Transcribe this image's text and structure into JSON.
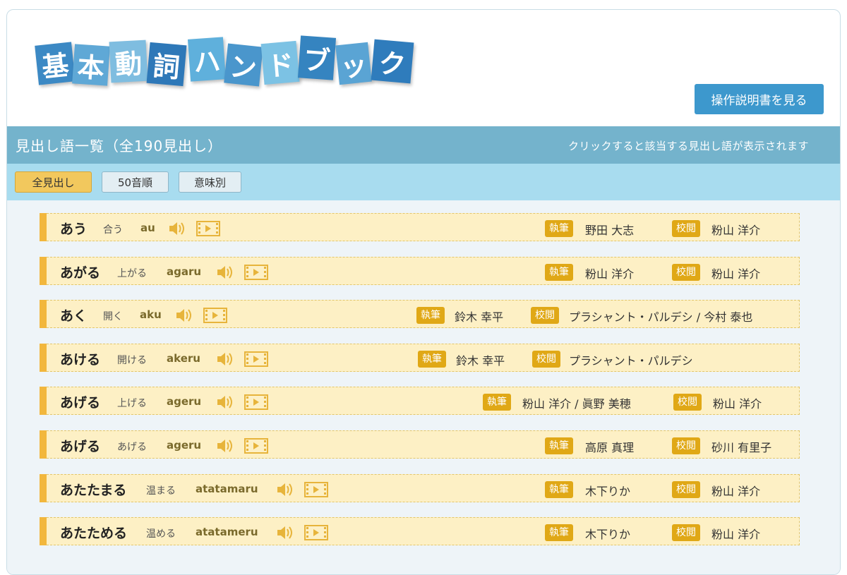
{
  "logo": {
    "chars": [
      "基",
      "本",
      "動",
      "詞",
      "ハ",
      "ン",
      "ド",
      "ブ",
      "ッ",
      "ク"
    ],
    "colors": [
      "#3c89c4",
      "#5fa8d6",
      "#7fbde0",
      "#2e78b8",
      "#5fb0dc",
      "#4a96cc",
      "#7cc2e4",
      "#3584c0",
      "#5aa4d4",
      "#2f7cbc"
    ]
  },
  "header": {
    "manual_button": "操作説明書を見る"
  },
  "titlebar": {
    "title": "見出し語一覧（全190見出し）",
    "hint": "クリックすると該当する見出し語が表示されます"
  },
  "tabs": [
    {
      "label": "全見出し",
      "active": true
    },
    {
      "label": "50音順",
      "active": false
    },
    {
      "label": "意味別",
      "active": false
    }
  ],
  "labels": {
    "writer": "執筆",
    "reviewer": "校閲"
  },
  "entries": [
    {
      "word": "あう",
      "kanji": "合う",
      "romaji": "au",
      "writer": "野田 大志",
      "reviewer": "粉山 洋介"
    },
    {
      "word": "あがる",
      "kanji": "上がる",
      "romaji": "agaru",
      "writer": "粉山 洋介",
      "reviewer": "粉山 洋介"
    },
    {
      "word": "あく",
      "kanji": "開く",
      "romaji": "aku",
      "writer": "鈴木 幸平",
      "reviewer": "プラシャント・パルデシ / 今村 泰也"
    },
    {
      "word": "あける",
      "kanji": "開ける",
      "romaji": "akeru",
      "writer": "鈴木 幸平",
      "reviewer": "プラシャント・パルデシ"
    },
    {
      "word": "あげる",
      "kanji": "上げる",
      "romaji": "ageru",
      "writer": "粉山 洋介 / 眞野 美穂",
      "reviewer": "粉山 洋介"
    },
    {
      "word": "あげる",
      "kanji": "あげる",
      "romaji": "ageru",
      "writer": "高原 真理",
      "reviewer": "砂川 有里子"
    },
    {
      "word": "あたたまる",
      "kanji": "温まる",
      "romaji": "atatamaru",
      "writer": "木下りか",
      "reviewer": "粉山 洋介"
    },
    {
      "word": "あたためる",
      "kanji": "温める",
      "romaji": "atatameru",
      "writer": "木下りか",
      "reviewer": "粉山 洋介"
    }
  ]
}
